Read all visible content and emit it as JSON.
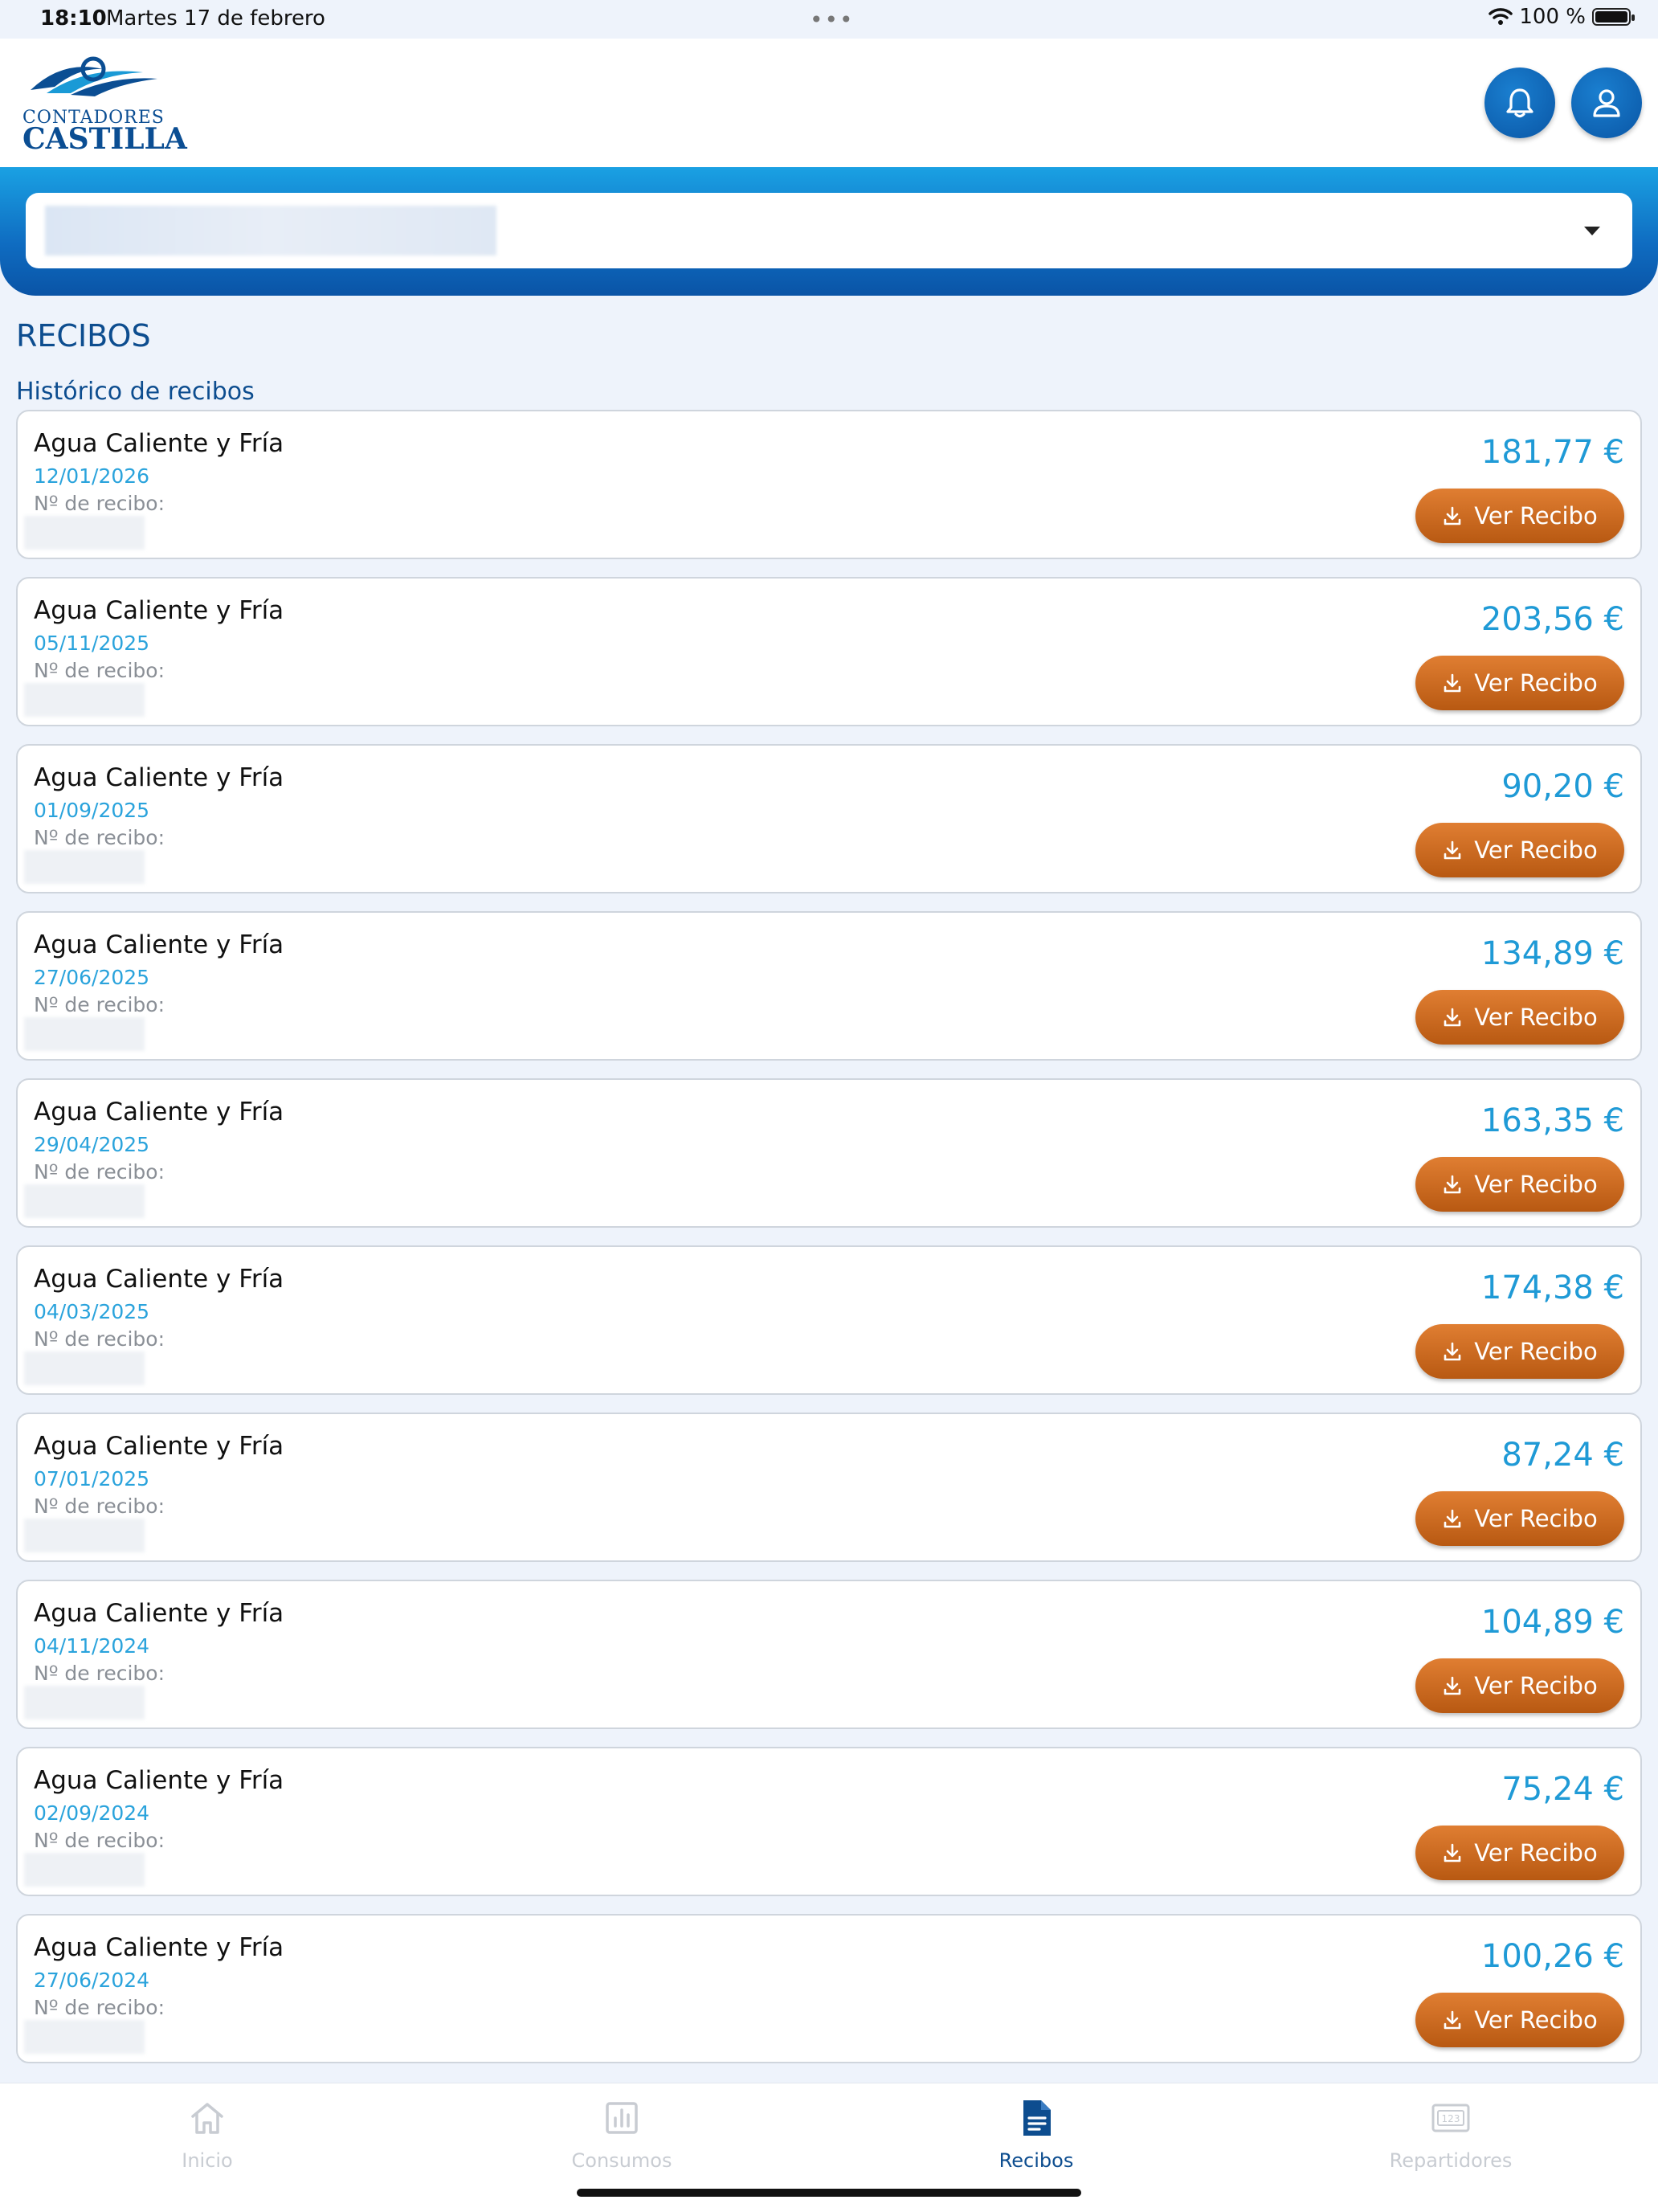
{
  "status_bar": {
    "time": "18:10",
    "date": "Martes 17 de febrero",
    "dots": "•••",
    "battery_text": "100 %"
  },
  "header": {
    "logo_line1": "CONTADORES",
    "logo_line2": "CASTILLA",
    "bell_icon": "bell-icon",
    "user_icon": "user-icon"
  },
  "selector": {
    "icon": "caret-down-icon"
  },
  "page": {
    "title": "RECIBOS",
    "section": "Histórico de recibos"
  },
  "receipts": [
    {
      "name": "Agua Caliente y Fría",
      "date": "12/01/2026",
      "number_label": "Nº de recibo:",
      "amount": "181,77 €",
      "button": "Ver Recibo"
    },
    {
      "name": "Agua Caliente y Fría",
      "date": "05/11/2025",
      "number_label": "Nº de recibo:",
      "amount": "203,56 €",
      "button": "Ver Recibo"
    },
    {
      "name": "Agua Caliente y Fría",
      "date": "01/09/2025",
      "number_label": "Nº de recibo:",
      "amount": "90,20 €",
      "button": "Ver Recibo"
    },
    {
      "name": "Agua Caliente y Fría",
      "date": "27/06/2025",
      "number_label": "Nº de recibo:",
      "amount": "134,89 €",
      "button": "Ver Recibo"
    },
    {
      "name": "Agua Caliente y Fría",
      "date": "29/04/2025",
      "number_label": "Nº de recibo:",
      "amount": "163,35 €",
      "button": "Ver Recibo"
    },
    {
      "name": "Agua Caliente y Fría",
      "date": "04/03/2025",
      "number_label": "Nº de recibo:",
      "amount": "174,38 €",
      "button": "Ver Recibo"
    },
    {
      "name": "Agua Caliente y Fría",
      "date": "07/01/2025",
      "number_label": "Nº de recibo:",
      "amount": "87,24 €",
      "button": "Ver Recibo"
    },
    {
      "name": "Agua Caliente y Fría",
      "date": "04/11/2024",
      "number_label": "Nº de recibo:",
      "amount": "104,89 €",
      "button": "Ver Recibo"
    },
    {
      "name": "Agua Caliente y Fría",
      "date": "02/09/2024",
      "number_label": "Nº de recibo:",
      "amount": "75,24 €",
      "button": "Ver Recibo"
    },
    {
      "name": "Agua Caliente y Fría",
      "date": "27/06/2024",
      "number_label": "Nº de recibo:",
      "amount": "100,26 €",
      "button": "Ver Recibo"
    }
  ],
  "tabbar": {
    "items": [
      {
        "label": "Inicio",
        "icon": "home-icon",
        "active": false
      },
      {
        "label": "Consumos",
        "icon": "bar-chart-icon",
        "active": false
      },
      {
        "label": "Recibos",
        "icon": "document-icon",
        "active": true
      },
      {
        "label": "Repartidores",
        "icon": "counter-icon",
        "active": false
      }
    ]
  },
  "colors": {
    "brand_blue": "#0d4d8f",
    "amount_blue": "#1f9ad6",
    "button_orange": "#c96a1f"
  }
}
